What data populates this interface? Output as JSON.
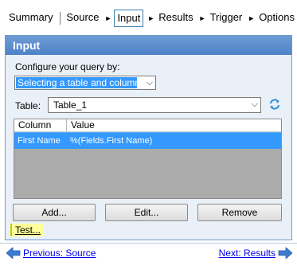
{
  "steps": {
    "summary": "Summary",
    "source": "Source",
    "input": "Input",
    "results": "Results",
    "trigger": "Trigger",
    "options": "Options"
  },
  "panel": {
    "title": "Input",
    "configure_label": "Configure your query by:",
    "configure_value": "Selecting a table and columns",
    "table_label": "Table:",
    "table_value": "Table_1"
  },
  "grid": {
    "columns": [
      "Column",
      "Value"
    ],
    "rows": [
      {
        "column": "First Name",
        "value": "%(Fields.First Name)"
      }
    ]
  },
  "buttons": {
    "add": "Add...",
    "edit": "Edit...",
    "remove": "Remove"
  },
  "test_link": "Test...",
  "nav": {
    "previous": "Previous: Source",
    "next": "Next: Results"
  },
  "colors": {
    "header_blue": "#5a8cd0",
    "selection_blue": "#3399ff",
    "panel_bg": "#eaf0f8",
    "highlight_yellow": "#ffff99"
  }
}
